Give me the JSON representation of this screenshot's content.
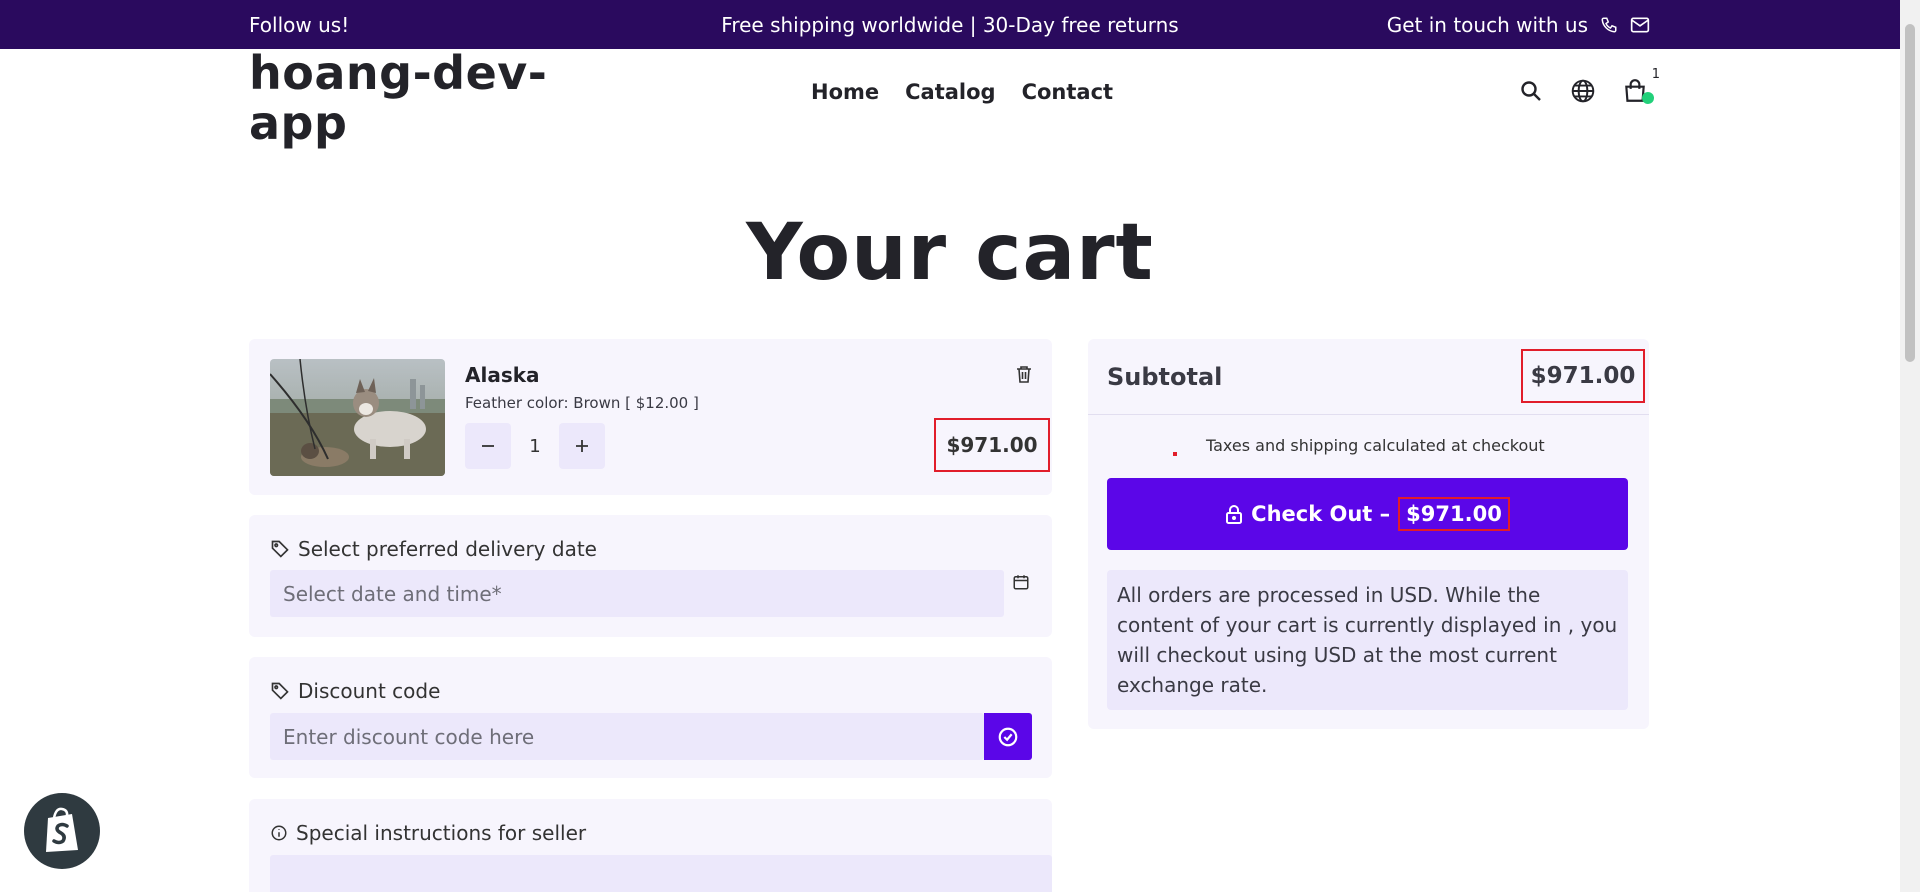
{
  "announcement": {
    "left": "Follow us!",
    "center": "Free shipping worldwide | 30-Day free returns",
    "right": "Get in touch with us"
  },
  "header": {
    "logo": "hoang-dev-app",
    "nav": [
      "Home",
      "Catalog",
      "Contact"
    ],
    "cart_count": "1"
  },
  "page": {
    "title": "Your cart"
  },
  "cart_item": {
    "name": "Alaska",
    "variant": "Feather color: Brown [ $12.00 ]",
    "quantity": "1",
    "price": "$971.00"
  },
  "delivery": {
    "label": "Select preferred delivery date",
    "placeholder": "Select date and time*"
  },
  "discount": {
    "label": "Discount code",
    "placeholder": "Enter discount code here"
  },
  "special": {
    "label": "Special instructions for seller"
  },
  "summary": {
    "subtotal_label": "Subtotal",
    "subtotal_value": "$971.00",
    "tax_note": "Taxes and shipping calculated at checkout",
    "checkout_label": "Check Out –",
    "checkout_value": "$971.00",
    "currency_note": "All orders are processed in USD. While the content of your cart is currently displayed in , you will checkout using USD at the most current exchange rate."
  },
  "colors": {
    "announcement_bg": "#2a0a5e",
    "accent": "#5b06e8",
    "card_bg": "#f7f5fd",
    "field_bg": "#ece8fb",
    "highlight": "#e11d2a",
    "cart_dot": "#22d07a"
  },
  "icons": [
    "phone-icon",
    "mail-icon",
    "search-icon",
    "globe-icon",
    "cart-icon",
    "trash-icon",
    "minus-icon",
    "plus-icon",
    "tag-icon",
    "calendar-icon",
    "check-circle-icon",
    "info-icon",
    "lock-icon",
    "shopify-icon"
  ]
}
